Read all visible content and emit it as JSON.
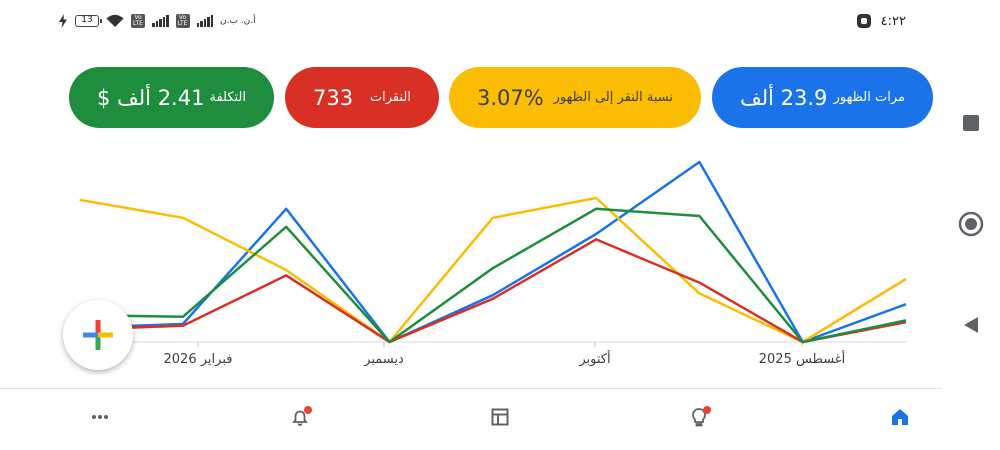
{
  "status_bar": {
    "time": "٤:٢٢",
    "battery_level": "13",
    "carrier_text": "أ.ن. ب.ن",
    "volte_label": "Vo LTE"
  },
  "metrics": {
    "impressions": {
      "label": "مرات الظهور",
      "value": "23.9 ألف",
      "color": "#1a73e8"
    },
    "ctr": {
      "label": "نسبة النقر إلى الظهور",
      "value": "3.07%",
      "color": "#fbbc04"
    },
    "clicks": {
      "label": "النقرات",
      "value": "733",
      "color": "#d93025"
    },
    "cost": {
      "label": "التكلفة",
      "value": "2.41 ألف $",
      "color": "#1e8e3e"
    }
  },
  "chart_data": {
    "type": "line",
    "x_labels": [
      "أغسطس 2025",
      "أكتوبر",
      "ديسمبر",
      "فبراير 2026"
    ],
    "grid": false,
    "series": [
      {
        "name": "مرات الظهور",
        "color": "#1a73e8",
        "values": [
          0.21,
          0.0,
          1.0,
          0.6,
          0.26,
          0.0,
          0.74,
          0.1,
          0.08
        ]
      },
      {
        "name": "نسبة النقر إلى الظهور",
        "color": "#fbbc04",
        "values": [
          0.35,
          0.0,
          0.27,
          0.8,
          0.69,
          0.0,
          0.4,
          0.69,
          0.79
        ]
      },
      {
        "name": "النقرات",
        "color": "#d93025",
        "values": [
          0.11,
          0.0,
          0.33,
          0.57,
          0.24,
          0.0,
          0.37,
          0.09,
          0.07
        ]
      },
      {
        "name": "التكلفة",
        "color": "#1e8e3e",
        "values": [
          0.12,
          0.0,
          0.7,
          0.74,
          0.41,
          0.0,
          0.64,
          0.14,
          0.15
        ]
      }
    ]
  },
  "bottom_nav": {
    "items": [
      "home-icon",
      "lightbulb-icon",
      "table-icon",
      "bell-icon",
      "more-icon"
    ]
  }
}
